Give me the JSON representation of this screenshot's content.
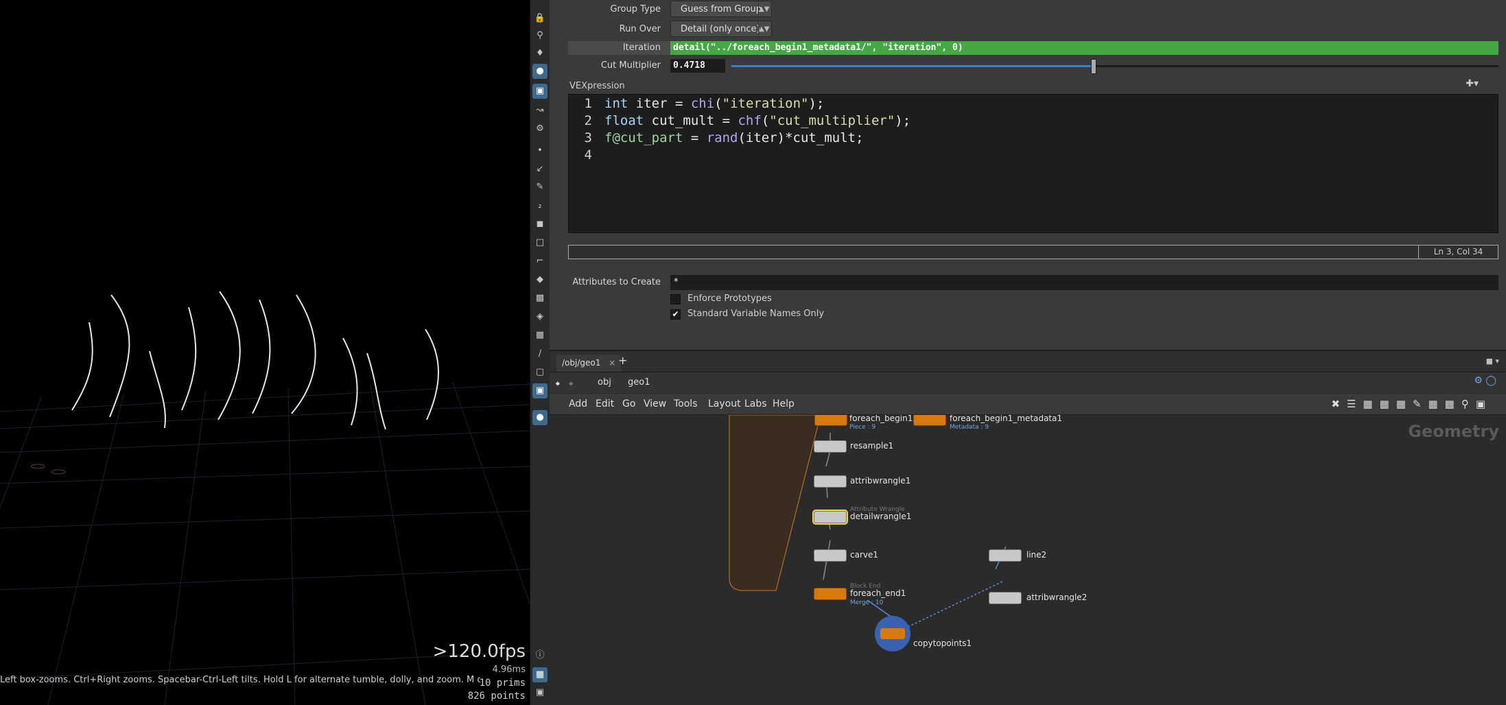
{
  "viewport": {
    "fps": ">120.0fps",
    "ms": "4.96ms",
    "hint": "Left box-zooms. Ctrl+Right zooms. Spacebar-Ctrl-Left tilts. Hold L for alternate tumble, dolly, and zoom. M or Alt+M for First Person",
    "prims": "10  prims",
    "points": "826 points"
  },
  "toolbar_icons": [
    "lock-icon",
    "pin-icon",
    "light-icon",
    "bulb-icon",
    "camera-icon",
    "handle-icon",
    "select-icon",
    "point-icon",
    "edge-icon",
    "pen-icon",
    "number-icon",
    "brush-icon",
    "paint-icon",
    "curve-icon",
    "sculpt-icon",
    "box-icon",
    "gem-icon",
    "image-icon",
    "ruler-icon",
    "square-icon",
    "view-icon",
    "info-icon",
    "layout-icon",
    "display-icon"
  ],
  "params": {
    "group_type": {
      "label": "Group Type",
      "value": "Guess from Group"
    },
    "run_over": {
      "label": "Run Over",
      "value": "Detail (only once)"
    },
    "iteration": {
      "label": "Iteration",
      "value": "detail(\"../foreach_begin1_metadata1/\", \"iteration\", 0)"
    },
    "cut_multiplier": {
      "label": "Cut Multiplier",
      "value": "0.4718",
      "slider_fraction": 0.4718
    },
    "vexpression_label": "VEXpression",
    "code_lines": [
      "1",
      "2",
      "3",
      "4"
    ],
    "cursor_pos": "Ln 3, Col 34",
    "attributes_to_create": {
      "label": "Attributes to Create",
      "value": "*"
    },
    "enforce_prototypes": {
      "label": "Enforce Prototypes",
      "checked": false
    },
    "standard_var_names": {
      "label": "Standard Variable Names Only",
      "checked": true
    }
  },
  "network": {
    "tab": "/obj/geo1",
    "path": {
      "root": "obj",
      "current": "geo1"
    },
    "menus": [
      "Add",
      "Edit",
      "Go",
      "View",
      "Tools",
      "Layout",
      "Labs",
      "Help"
    ],
    "watermark": "Geometry",
    "nodes": {
      "foreach_begin1": {
        "name": "foreach_begin1",
        "sub": "Piece : 9"
      },
      "metadata": {
        "name": "foreach_begin1_metadata1",
        "sub": "Metadata : 9"
      },
      "resample": {
        "name": "resample1"
      },
      "attribwrangle1": {
        "name": "attribwrangle1"
      },
      "detailwrangle": {
        "name": "detailwrangle1",
        "type": "Attribute Wrangle"
      },
      "carve": {
        "name": "carve1"
      },
      "foreach_end": {
        "name": "foreach_end1",
        "type": "Block End",
        "sub": "Merge : 10"
      },
      "line2": {
        "name": "line2"
      },
      "attribwrangle2": {
        "name": "attribwrangle2"
      },
      "copytopoints": {
        "name": "copytopoints1"
      }
    }
  }
}
